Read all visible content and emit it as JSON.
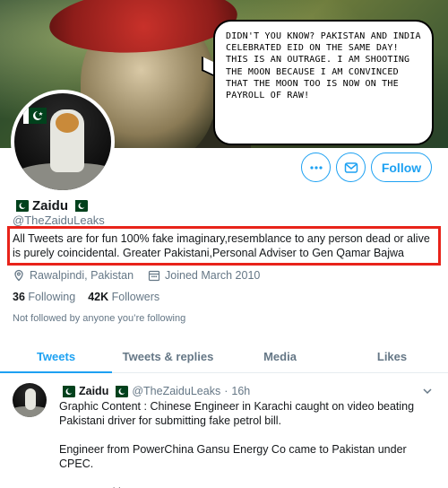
{
  "banner": {
    "bubble_text": "Didn't you know? Pakistan and India celebrated Eid on the same day! This is an outrage. I am shooting the moon because I am convinced that the moon too is now on the payroll of RAW!"
  },
  "profile": {
    "display_name": "Zaidu",
    "handle": "@TheZaiduLeaks",
    "bio": "All Tweets are for fun 100% fake imaginary,resemblance to any person dead or alive is purely coincidental. Greater Pakistani,Personal Adviser to Gen Qamar Bajwa",
    "location": "Rawalpindi, Pakistan",
    "joined": "Joined March 2010",
    "following_count": "36",
    "following_label": "Following",
    "followers_count": "42K",
    "followers_label": "Followers",
    "not_followed_text": "Not followed by anyone you’re following"
  },
  "actions": {
    "more_icon": "more-icon",
    "message_icon": "envelope-icon",
    "follow_label": "Follow"
  },
  "tabs": [
    {
      "label": "Tweets",
      "active": true
    },
    {
      "label": "Tweets & replies",
      "active": false
    },
    {
      "label": "Media",
      "active": false
    },
    {
      "label": "Likes",
      "active": false
    }
  ],
  "tweet": {
    "name": "Zaidu",
    "handle": "@TheZaiduLeaks",
    "separator": "·",
    "time": "16h",
    "body": "Graphic Content : Chinese Engineer in Karachi caught on video beating Pakistani driver for submitting fake petrol bill.\n\nEngineer from PowerChina Gansu Energy Co came to Pakistan under CPEC.\n\nMr Dan Pakistan's ..."
  },
  "colors": {
    "accent": "#1da1f2",
    "highlight_border": "#e8231a",
    "muted": "#657786",
    "flag_green": "#01411c"
  }
}
